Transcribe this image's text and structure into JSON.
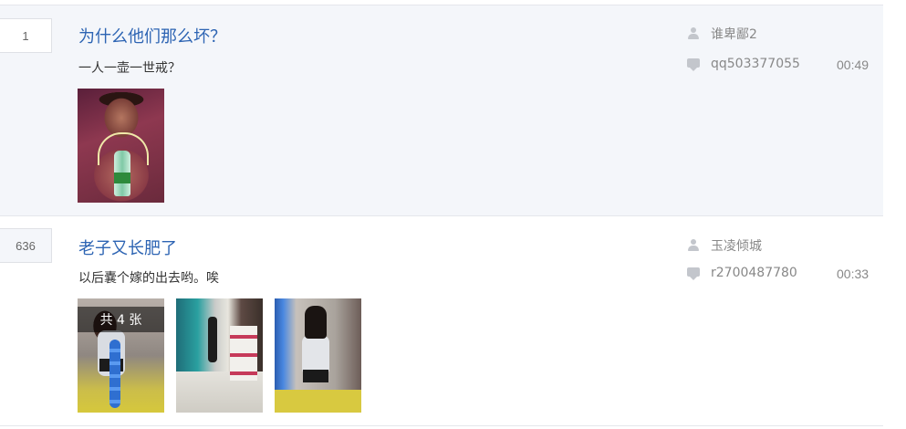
{
  "threads": [
    {
      "reply_count": "1",
      "title": "为什么他们那么坏？",
      "excerpt": "一人一壶一世戒？",
      "author": "谁卑鄙2",
      "last_reply_user": "qq503377055",
      "last_reply_time": "00:49",
      "images": 1
    },
    {
      "reply_count": "636",
      "title": "老子又长肥了",
      "excerpt": "以后嚢个嫁的出去哟。唉",
      "author": "玉凌倾城",
      "last_reply_user": "r2700487780",
      "last_reply_time": "00:33",
      "images": 3,
      "image_overlay": "共 4 张"
    }
  ],
  "icons": {
    "author": "person-icon",
    "reply": "comment-icon"
  },
  "colors": {
    "title": "#2d64b3",
    "highlight_bg": "#f4f6fa",
    "meta_text": "#888888"
  }
}
